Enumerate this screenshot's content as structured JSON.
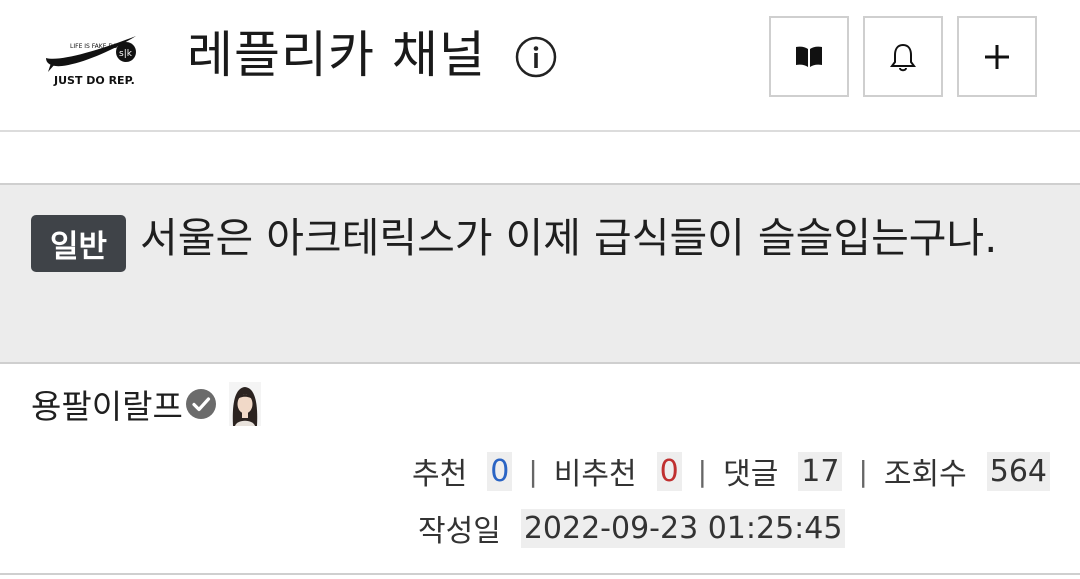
{
  "header": {
    "logo_slogan": "JUST DO REP.",
    "logo_small_text": "LIFE IS FAKE DO",
    "logo_badge_text": "s|k",
    "channel_title": "레플리카 채널",
    "buttons": [
      {
        "icon": "book-icon"
      },
      {
        "icon": "bell-icon"
      },
      {
        "icon": "plus-icon"
      }
    ]
  },
  "post": {
    "category": "일반",
    "title": "서울은 아크테릭스가 이제 급식들이 슬슬입는구나.",
    "author": "용팔이랄프",
    "stats": {
      "up_label": "추천",
      "up_value": "0",
      "down_label": "비추천",
      "down_value": "0",
      "comments_label": "댓글",
      "comments_value": "17",
      "views_label": "조회수",
      "views_value": "564"
    },
    "date_label": "작성일",
    "date_value": "2022-09-23 01:25:45"
  },
  "colors": {
    "badge_bg": "#3f4348",
    "title_bg": "#ececec",
    "up_color": "#2a64c4",
    "down_color": "#c03030"
  }
}
